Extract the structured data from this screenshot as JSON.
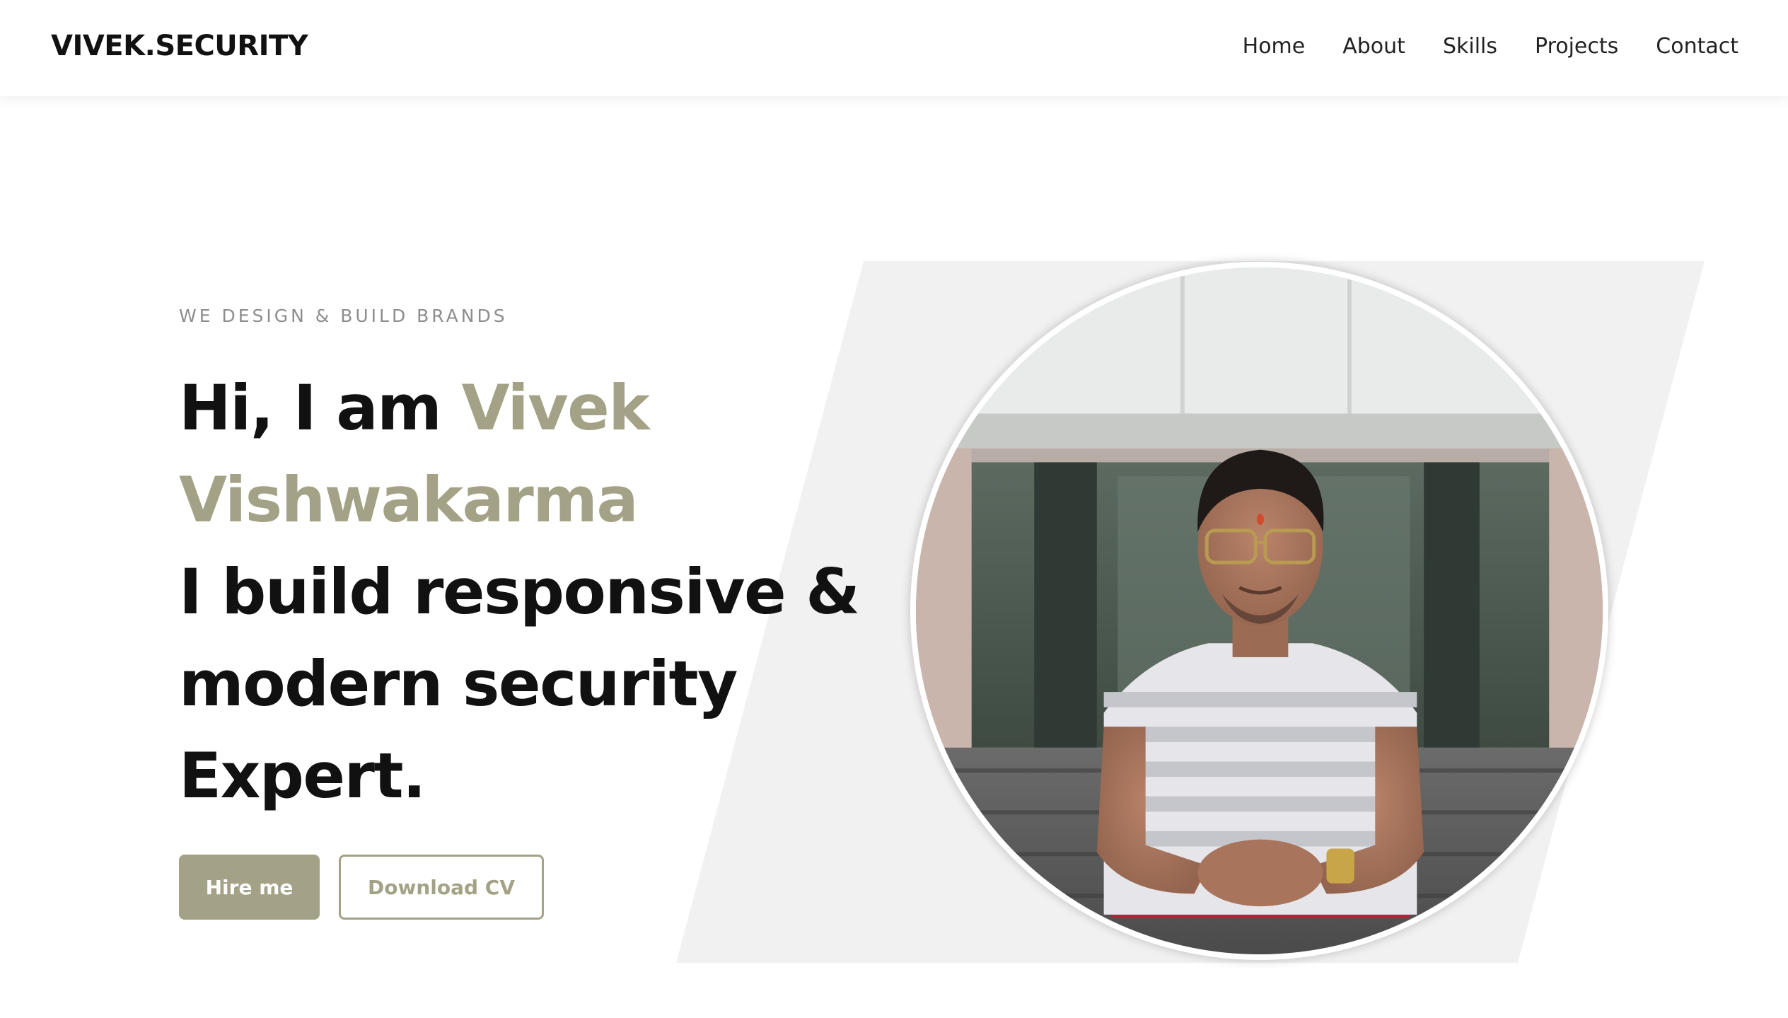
{
  "header": {
    "logo": "VIVEK.SECURITY",
    "nav": [
      "Home",
      "About",
      "Skills",
      "Projects",
      "Contact"
    ]
  },
  "hero": {
    "eyebrow": "WE DESIGN & BUILD BRANDS",
    "greeting": "Hi, I am",
    "first_name": "Vivek",
    "last_name": "Vishwakarma",
    "tagline_line1": "I build responsive &",
    "tagline_line2": "modern security",
    "tagline_line3": "Expert.",
    "hire_button": "Hire me",
    "cv_button": "Download CV"
  },
  "colors": {
    "accent": "#a4a286",
    "text": "#111111",
    "panel": "#f1f1f1"
  },
  "icons": {
    "portrait": "profile-photo"
  }
}
